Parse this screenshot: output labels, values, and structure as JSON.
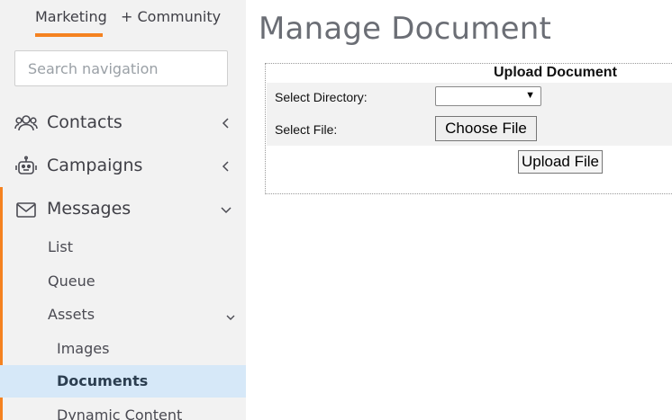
{
  "sidebar": {
    "tabs": [
      {
        "label": "Marketing"
      },
      {
        "label": "+ Community"
      }
    ],
    "search": {
      "placeholder": "Search navigation"
    },
    "items": [
      {
        "label": "Contacts"
      },
      {
        "label": "Campaigns"
      },
      {
        "label": "Messages"
      }
    ],
    "sub_items": [
      {
        "label": "List"
      },
      {
        "label": "Queue"
      },
      {
        "label": "Assets"
      },
      {
        "label": "Images"
      },
      {
        "label": "Documents"
      },
      {
        "label": "Dynamic Content"
      }
    ]
  },
  "main": {
    "title": "Manage Document",
    "panel": {
      "heading": "Upload Document",
      "directory_label": "Select Directory:",
      "directory_arrow": "▼",
      "file_label": "Select File:",
      "choose_label": "Choose File",
      "upload_label": "Upload File"
    }
  },
  "colors": {
    "accent": "#f58220",
    "active_bg": "#d6e8f8",
    "sidebar_bg": "#f2f2f2"
  },
  "icons": [
    "users-icon",
    "robot-icon",
    "envelope-icon",
    "chevron-left-icon",
    "chevron-down-icon"
  ]
}
